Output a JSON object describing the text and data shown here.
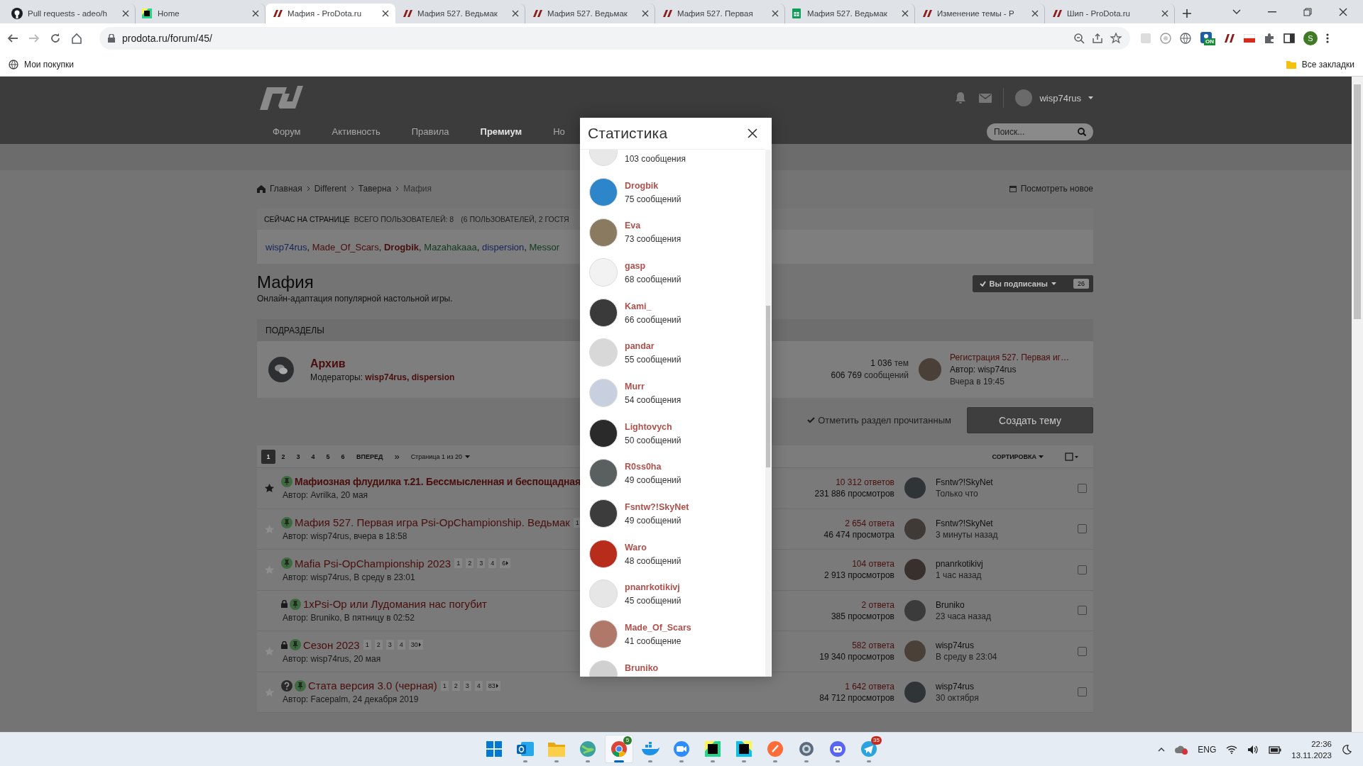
{
  "browser": {
    "tabs": [
      {
        "kind": "github",
        "title": "Pull requests - adeo/h",
        "selected": false
      },
      {
        "kind": "pycharm",
        "title": "Home",
        "selected": false
      },
      {
        "kind": "prodota",
        "title": "Мафия - ProDota.ru",
        "selected": true
      },
      {
        "kind": "prodota",
        "title": "Мафия 527. Ведьмак",
        "selected": false
      },
      {
        "kind": "prodota",
        "title": "Мафия 527. Ведьмак",
        "selected": false
      },
      {
        "kind": "prodota",
        "title": "Мафия 527. Первая",
        "selected": false
      },
      {
        "kind": "sheets",
        "title": "Мафия 527. Ведьмак",
        "selected": false
      },
      {
        "kind": "prodota",
        "title": "Изменение темы - P",
        "selected": false
      },
      {
        "kind": "prodota",
        "title": "Шип - ProDota.ru",
        "selected": false
      }
    ],
    "url": "prodota.ru/forum/45/",
    "extension_badge": "ON",
    "profile_initial": "S",
    "bookmark": "Мои покупки",
    "all_bookmarks": "Все закладки"
  },
  "site": {
    "nav": [
      {
        "label": "Форум",
        "highlight": false
      },
      {
        "label": "Активность",
        "highlight": false
      },
      {
        "label": "Правила",
        "highlight": false
      },
      {
        "label": "Премиум",
        "highlight": true
      },
      {
        "label": "Но",
        "highlight": false
      }
    ],
    "user": "wisp74rus",
    "search_placeholder": "Поиск..."
  },
  "breadcrumbs": [
    "Главная",
    "Different",
    "Таверна",
    "Мафия"
  ],
  "view_new": "Посмотреть новое",
  "online": {
    "label": "СЕЙЧАС НА СТРАНИЦЕ",
    "total": "ВСЕГО ПОЛЬЗОВАТЕЛЕЙ: 8",
    "breakdown": "(6 ПОЛЬЗОВАТЕЛЕЙ, 2 ГОСТЯ",
    "separator": ",",
    "users": [
      {
        "name": "wisp74rus",
        "color": "#16235a",
        "bold": false
      },
      {
        "name": "Made_Of_Scars",
        "color": "#4a0e0e",
        "bold": false
      },
      {
        "name": "Drogbik",
        "color": "#4a0e0e",
        "bold": true
      },
      {
        "name": "Mazahakaaa",
        "color": "#0f3a1c",
        "bold": false
      },
      {
        "name": "dispersion",
        "color": "#16235a",
        "bold": false
      },
      {
        "name": "Messor",
        "color": "#0f3a1c",
        "bold": false
      }
    ]
  },
  "forum": {
    "title": "Мафия",
    "description": "Онлайн-адаптация популярной настольной игры.",
    "subscribe": "Вы подписаны",
    "followers": "26"
  },
  "subforums": {
    "heading": "ПОДРАЗДЕЛЫ",
    "items": [
      {
        "name": "Архив",
        "moderators_label": "Модераторы:",
        "moderators": "wisp74rus, dispersion",
        "topics": "1 036",
        "topics_label": "тем",
        "posts": "606 769",
        "posts_label": "сообщений",
        "last_title": "Регистрация 527. Первая иг…",
        "last_author": "Автор: wisp74rus",
        "last_time": "Вчера в 19:45"
      }
    ]
  },
  "actions": {
    "mark_read": "Отметить раздел прочитанным",
    "create": "Создать тему"
  },
  "pagination": {
    "pages": [
      {
        "label": "1",
        "selected": true
      },
      {
        "label": "2",
        "selected": false
      },
      {
        "label": "3",
        "selected": false
      },
      {
        "label": "4",
        "selected": false
      },
      {
        "label": "5",
        "selected": false
      },
      {
        "label": "6",
        "selected": false
      }
    ],
    "next": "ВПЕРЕД",
    "last": "»",
    "page_of": "Страница 1 из 20",
    "sort": "СОРТИРОВКА"
  },
  "topics": [
    {
      "star_visible": true,
      "starred": true,
      "unread": true,
      "locked": false,
      "question": false,
      "title": "Мафиозная флудилка т.21. Бессмысленная и беспощадная",
      "author": "Автор: Avrilka, 20 мая",
      "replies": "10 312 ответов",
      "views": "231 886 просмотров",
      "last_user": "Fsntw?!SkyNet",
      "last_time": "Только что",
      "checked": false
    },
    {
      "star_visible": true,
      "starred": false,
      "unread": false,
      "locked": false,
      "question": false,
      "title": "Мафия 527. Первая игра Psi-OpChampionship. Ведьмак",
      "pages": [
        "1"
      ],
      "author": "Автор: wisp74rus, вчера в 18:58",
      "replies": "2 654 ответа",
      "views": "46 474 просмотра",
      "last_user": "Fsntw?!SkyNet",
      "last_time": "3 минуты назад",
      "checked": false
    },
    {
      "star_visible": true,
      "starred": false,
      "unread": false,
      "locked": false,
      "question": false,
      "title": "Mafia Psi-OpChampionship 2023",
      "pages": [
        "1",
        "2",
        "3",
        "4",
        "6"
      ],
      "author": "Автор: wisp74rus, В среду в 23:01",
      "replies": "104 ответа",
      "views": "2 913 просмотров",
      "last_user": "pnanrkotikivj",
      "last_time": "1 час назад",
      "checked": false
    },
    {
      "star_visible": false,
      "unread": false,
      "locked": true,
      "question": false,
      "title": "1xPsi-Op или Лудомания нас погубит",
      "author": "Автор: Bruniko, В пятницу в 02:52",
      "replies": "2 ответа",
      "views": "385 просмотров",
      "last_user": "Bruniko",
      "last_time": "23 часа назад",
      "checked": false
    },
    {
      "star_visible": true,
      "starred": false,
      "unread": false,
      "locked": true,
      "question": false,
      "title": "Сезон 2023",
      "pages": [
        "1",
        "2",
        "3",
        "4",
        "30"
      ],
      "author": "Автор: wisp74rus, 20 мая",
      "replies": "582 ответа",
      "views": "19 340 просмотров",
      "last_user": "wisp74rus",
      "last_time": "В среду в 23:04",
      "checked": false
    },
    {
      "star_visible": true,
      "starred": false,
      "unread": false,
      "locked": false,
      "question": true,
      "title": "Стата версия 3.0 (черная)",
      "pages": [
        "1",
        "2",
        "3",
        "4",
        "83"
      ],
      "author": "Автор: Facepalm, 24 декабря 2019",
      "replies": "1 642 ответа",
      "views": "84 712 просмотров",
      "last_user": "wisp74rus",
      "last_time": "30 октября",
      "checked": false
    }
  ],
  "modal": {
    "title": "Статистика",
    "items": [
      {
        "count": "103 сообщения"
      },
      {
        "name": "Drogbik",
        "count": "75 сообщений"
      },
      {
        "name": "Eva",
        "count": "73 сообщения"
      },
      {
        "name": "gasp",
        "count": "68 сообщений"
      },
      {
        "name": "Kami_",
        "count": "66 сообщений"
      },
      {
        "name": "pandar",
        "count": "55 сообщений"
      },
      {
        "name": "Murr",
        "count": "54 сообщения"
      },
      {
        "name": "Lightovych",
        "count": "50 сообщений"
      },
      {
        "name": "R0ss0ha",
        "count": "49 сообщений"
      },
      {
        "name": "Fsntw?!SkyNet",
        "count": "49 сообщений"
      },
      {
        "name": "Waro",
        "count": "48 сообщений"
      },
      {
        "name": "pnanrkotikivj",
        "count": "45 сообщений"
      },
      {
        "name": "Made_Of_Scars",
        "count": "41 сообщение"
      },
      {
        "name": "Bruniko"
      }
    ]
  },
  "taskbar": {
    "apps": [
      {
        "kind": "windows",
        "running": false,
        "selected": false
      },
      {
        "kind": "outlook",
        "running": true,
        "selected": false
      },
      {
        "kind": "explorer",
        "running": true,
        "selected": false
      },
      {
        "kind": "maps",
        "running": true,
        "selected": false
      },
      {
        "kind": "chrome",
        "running": true,
        "selected": true,
        "badge": "5"
      },
      {
        "kind": "docker",
        "running": true,
        "selected": false
      },
      {
        "kind": "zoom",
        "running": true,
        "selected": false
      },
      {
        "kind": "pycharm",
        "running": true,
        "selected": false
      },
      {
        "kind": "webstorm",
        "running": true,
        "selected": false
      },
      {
        "kind": "postman",
        "running": true,
        "selected": false
      },
      {
        "kind": "settings",
        "running": true,
        "selected": false
      },
      {
        "kind": "discord",
        "running": true,
        "selected": false
      },
      {
        "kind": "telegram",
        "running": true,
        "selected": false,
        "badge": "35"
      }
    ],
    "language": "ENG",
    "time": "22:36",
    "date": "13.11.2023"
  }
}
